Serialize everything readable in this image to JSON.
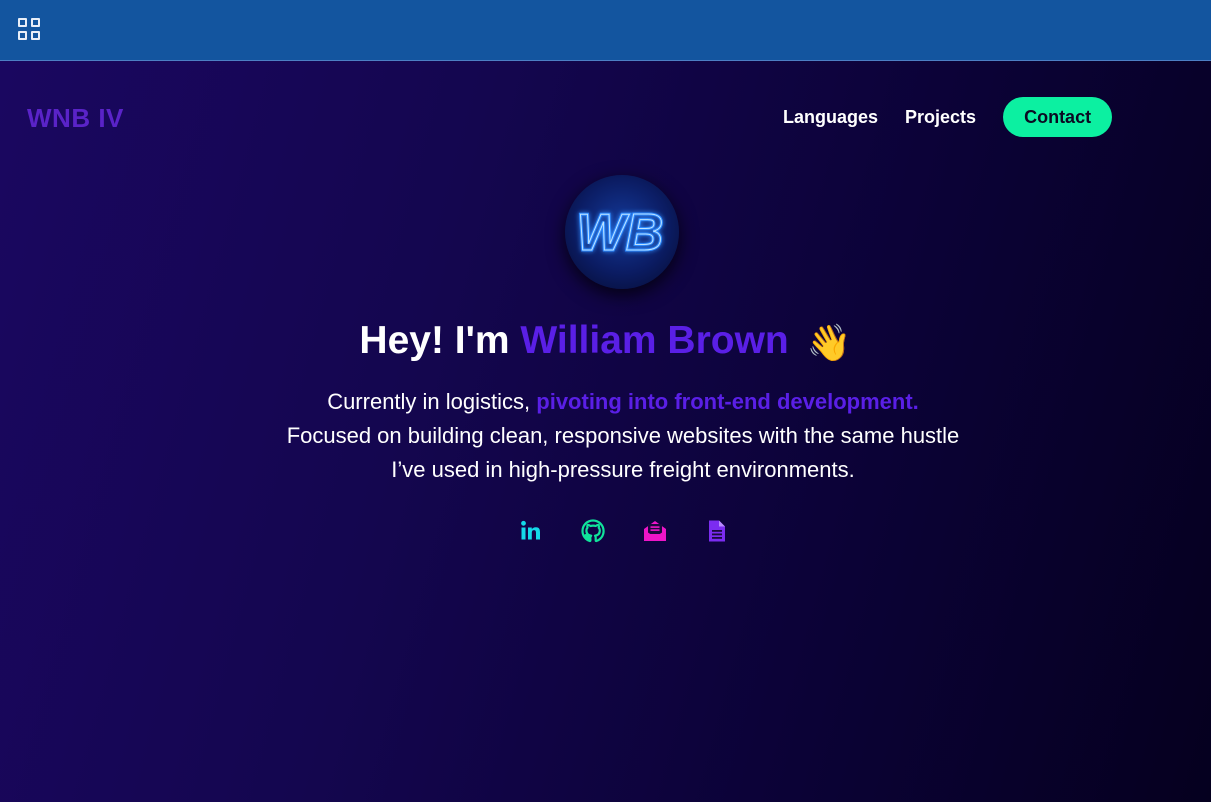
{
  "header": {
    "apps_icon": "grid-icon"
  },
  "site": {
    "brand": "WNB IV",
    "nav": [
      {
        "label": "Languages"
      },
      {
        "label": "Projects"
      }
    ],
    "contact_label": "Contact",
    "avatar_text": "WB"
  },
  "hero": {
    "greeting": "Hey! I'm ",
    "name": "William Brown",
    "wave_emoji": "👋",
    "sub_before": "Currently in logistics, ",
    "sub_highlight": "pivoting into front-end development.",
    "sub_after": " Focused on building clean, responsive websites with the same hustle I’ve used in high-pressure freight environments."
  },
  "socials": [
    {
      "icon": "linkedin-icon",
      "color": "#14d9e8"
    },
    {
      "icon": "github-icon",
      "color": "#10e39b"
    },
    {
      "icon": "mail-open-icon",
      "color": "#ee15c9"
    },
    {
      "icon": "document-icon",
      "color": "#7b2cf0"
    }
  ],
  "colors": {
    "topbar": "#13559f",
    "accent_purple": "#5a1fe6",
    "contact_green": "#0cf0a1"
  }
}
